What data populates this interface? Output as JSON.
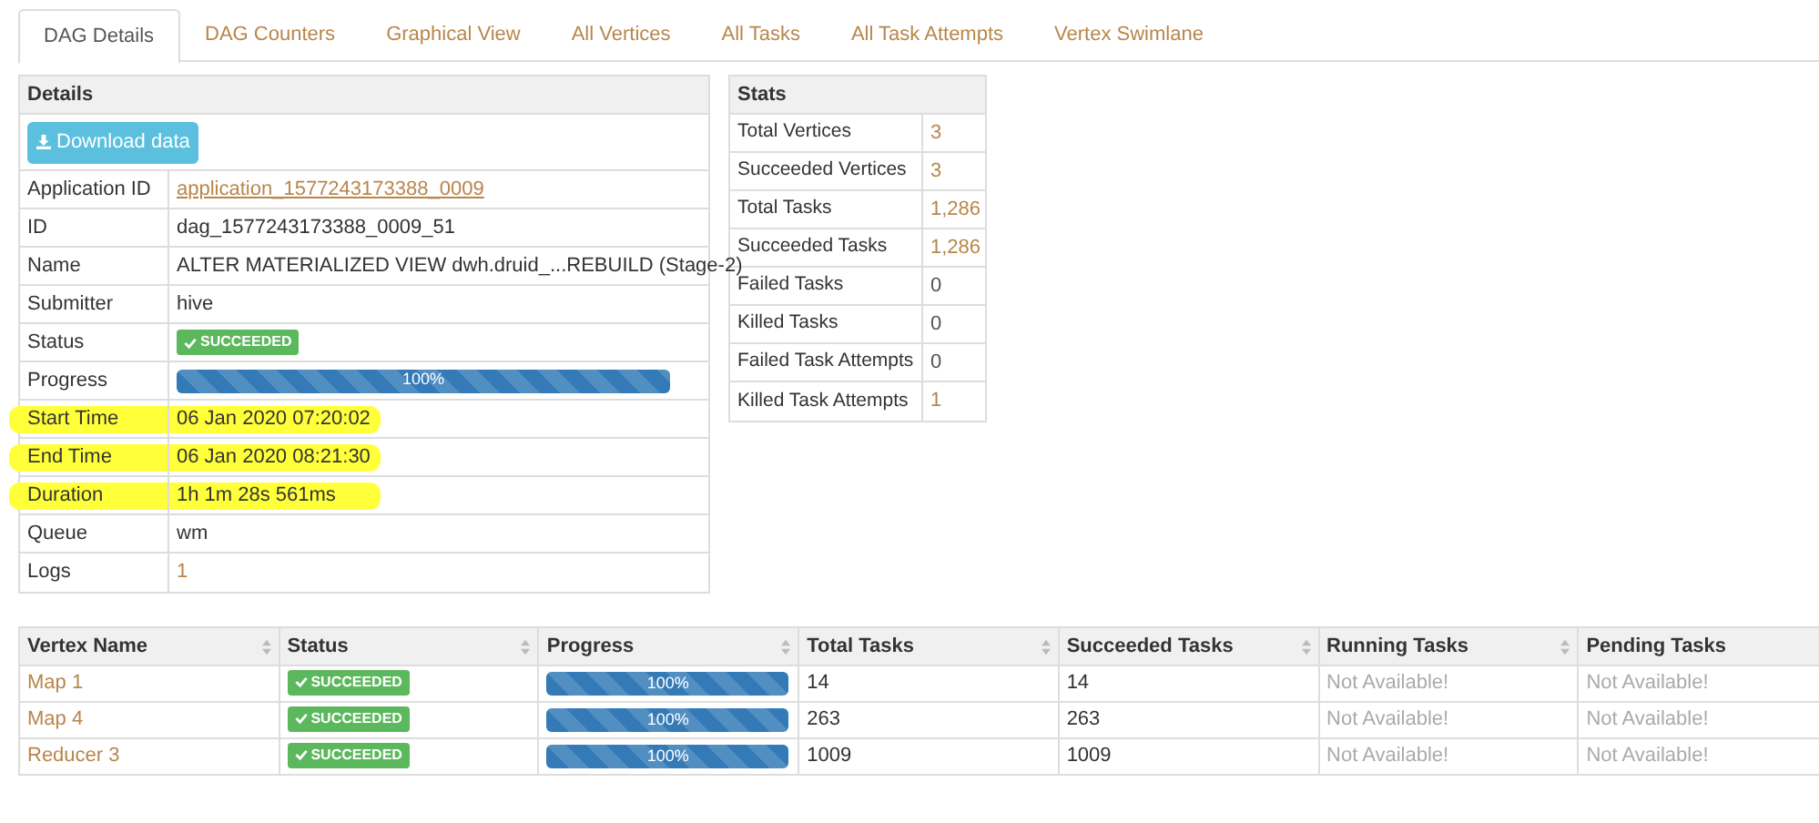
{
  "tabs": [
    {
      "label": "DAG Details",
      "selected": true
    },
    {
      "label": "DAG Counters",
      "selected": false
    },
    {
      "label": "Graphical View",
      "selected": false
    },
    {
      "label": "All Vertices",
      "selected": false
    },
    {
      "label": "All Tasks",
      "selected": false
    },
    {
      "label": "All Task Attempts",
      "selected": false
    },
    {
      "label": "Vertex Swimlane",
      "selected": false
    }
  ],
  "details": {
    "title": "Details",
    "download_button": "Download data",
    "rows": [
      {
        "label": "Application ID",
        "kind": "link",
        "value": "application_1577243173388_0009",
        "highlighted": false
      },
      {
        "label": "ID",
        "kind": "text",
        "value": "dag_1577243173388_0009_51",
        "highlighted": false
      },
      {
        "label": "Name",
        "kind": "text",
        "value": "ALTER MATERIALIZED VIEW dwh.druid_...REBUILD (Stage-2)",
        "highlighted": false
      },
      {
        "label": "Submitter",
        "kind": "text",
        "value": "hive",
        "highlighted": false
      },
      {
        "label": "Status",
        "kind": "status",
        "value": "SUCCEEDED",
        "highlighted": false
      },
      {
        "label": "Progress",
        "kind": "progress",
        "value": "100%",
        "level": 1,
        "highlighted": false
      },
      {
        "label": "Start Time",
        "kind": "text",
        "value": "06 Jan 2020 07:20:02",
        "highlighted": true
      },
      {
        "label": "End Time",
        "kind": "text",
        "value": "06 Jan 2020 08:21:30",
        "highlighted": true
      },
      {
        "label": "Duration",
        "kind": "text",
        "value": "1h 1m 28s 561ms",
        "highlighted": true
      },
      {
        "label": "Queue",
        "kind": "text",
        "value": "wm",
        "highlighted": false
      },
      {
        "label": "Logs",
        "kind": "count",
        "value": "1",
        "highlighted": false
      }
    ]
  },
  "stats": {
    "title": "Stats",
    "rows": [
      {
        "label": "Total Vertices",
        "value": "3",
        "link": true
      },
      {
        "label": "Succeeded Vertices",
        "value": "3",
        "link": true
      },
      {
        "label": "Total Tasks",
        "value": "1,286",
        "link": true
      },
      {
        "label": "Succeeded Tasks",
        "value": "1,286",
        "link": true
      },
      {
        "label": "Failed Tasks",
        "value": "0",
        "link": false
      },
      {
        "label": "Killed Tasks",
        "value": "0",
        "link": false
      },
      {
        "label": "Failed Task Attempts",
        "value": "0",
        "link": false
      },
      {
        "label": "Killed Task Attempts",
        "value": "1",
        "link": true
      }
    ]
  },
  "vertices": {
    "columns": [
      "Vertex Name",
      "Status",
      "Progress",
      "Total Tasks",
      "Succeeded Tasks",
      "Running Tasks",
      "Pending Tasks"
    ],
    "rows": [
      {
        "name": "Map 1",
        "status": "SUCCEEDED",
        "progress": "100%",
        "level": 1,
        "total_tasks": "14",
        "succeeded_tasks": "14",
        "running_tasks": "Not Available!",
        "pending_tasks": "Not Available!"
      },
      {
        "name": "Map 4",
        "status": "SUCCEEDED",
        "progress": "100%",
        "level": 1,
        "total_tasks": "263",
        "succeeded_tasks": "263",
        "running_tasks": "Not Available!",
        "pending_tasks": "Not Available!"
      },
      {
        "name": "Reducer 3",
        "status": "SUCCEEDED",
        "progress": "100%",
        "level": 1,
        "total_tasks": "1009",
        "succeeded_tasks": "1009",
        "running_tasks": "Not Available!",
        "pending_tasks": "Not Available!"
      }
    ]
  }
}
